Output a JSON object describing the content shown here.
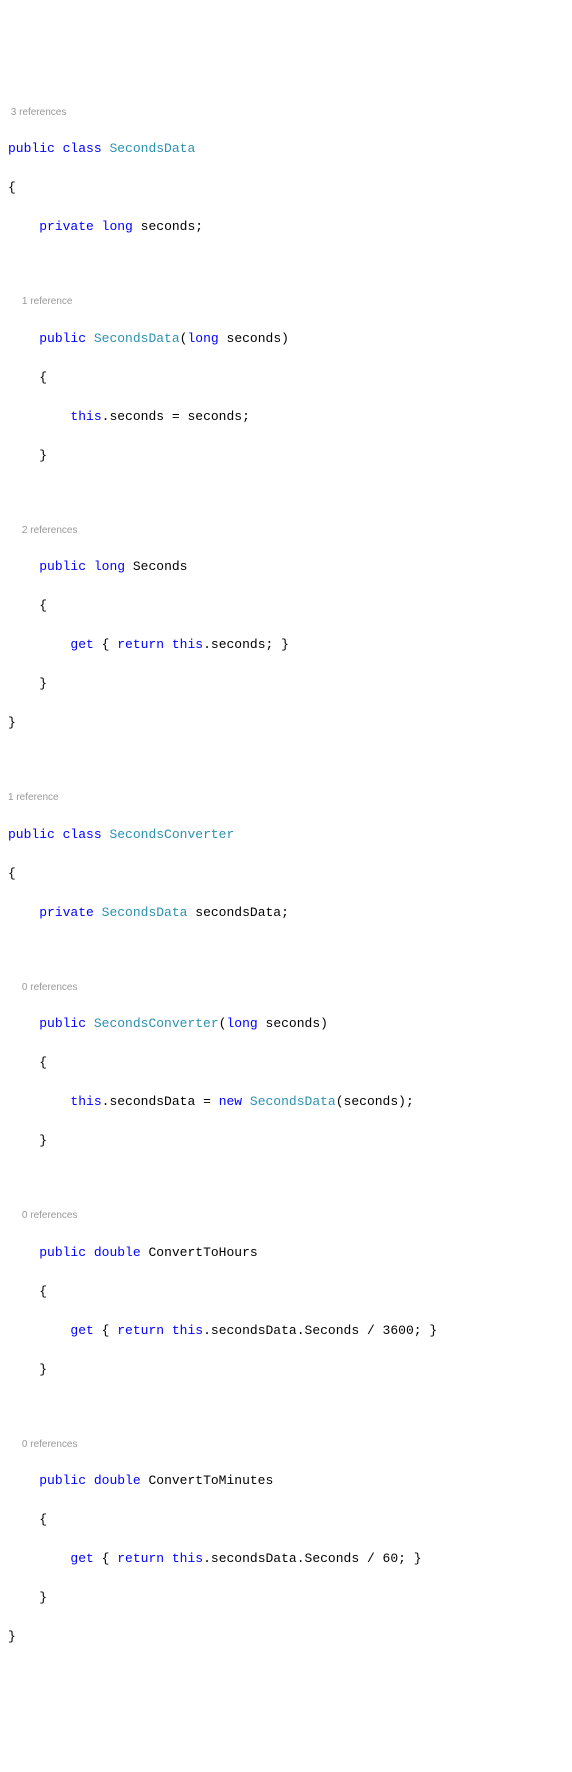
{
  "refs": {
    "class1": "3 references",
    "ctor1": "1 reference",
    "prop1": "2 references",
    "class2": "1 reference",
    "ctor2": "0 references",
    "prop2": "0 references",
    "prop3": "0 references"
  },
  "kw": {
    "public": "public",
    "class": "class",
    "private": "private",
    "long": "long",
    "this": "this",
    "get": "get",
    "return": "return",
    "double": "double",
    "new": "new"
  },
  "types": {
    "SecondsData": "SecondsData",
    "SecondsConverter": "SecondsConverter"
  },
  "idents": {
    "seconds_field": "seconds",
    "seconds_param": "seconds",
    "Seconds_prop": "Seconds",
    "secondsData_field": "secondsData",
    "ConvertToHours": "ConvertToHours",
    "ConvertToMinutes": "ConvertToMinutes"
  },
  "nums": {
    "n3600": "3600",
    "n60": "60"
  }
}
